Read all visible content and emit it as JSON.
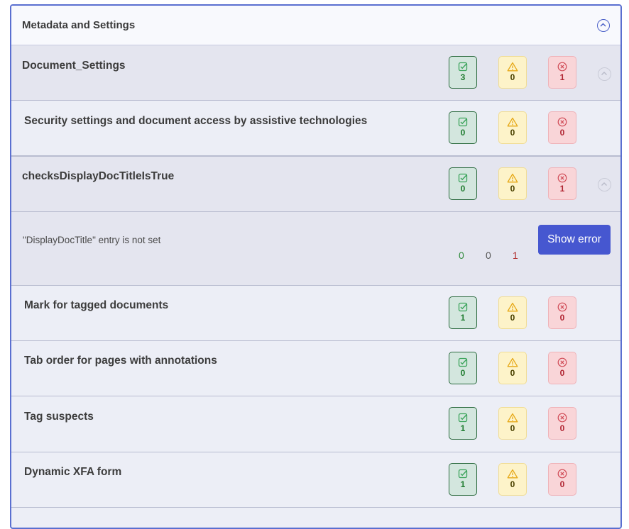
{
  "panel": {
    "title": "Metadata and Settings"
  },
  "colors": {
    "accent": "#4657d0",
    "pass": "#1e7b2e",
    "warn": "#e6a817",
    "error": "#b02532"
  },
  "rows": [
    {
      "title": "Document_Settings",
      "passed": "3",
      "warnings": "0",
      "errors": "1"
    },
    {
      "title": "Security settings and document access by assistive technologies",
      "passed": "0",
      "warnings": "0",
      "errors": "0"
    },
    {
      "title": "checksDisplayDocTitleIsTrue",
      "passed": "0",
      "warnings": "0",
      "errors": "1"
    },
    {
      "title": "Mark for tagged documents",
      "passed": "1",
      "warnings": "0",
      "errors": "0"
    },
    {
      "title": "Tab order for pages with annotations",
      "passed": "0",
      "warnings": "0",
      "errors": "0"
    },
    {
      "title": "Tag suspects",
      "passed": "1",
      "warnings": "0",
      "errors": "0"
    },
    {
      "title": "Dynamic XFA form",
      "passed": "1",
      "warnings": "0",
      "errors": "0"
    }
  ],
  "detail": {
    "message": "\"DisplayDocTitle\" entry is not set",
    "passed": "0",
    "warnings": "0",
    "errors": "1",
    "button_label": "Show error"
  },
  "icons": {
    "pass": "check-square-icon",
    "warn": "warning-triangle-icon",
    "error": "x-circle-icon",
    "collapse": "chevron-up-icon"
  }
}
